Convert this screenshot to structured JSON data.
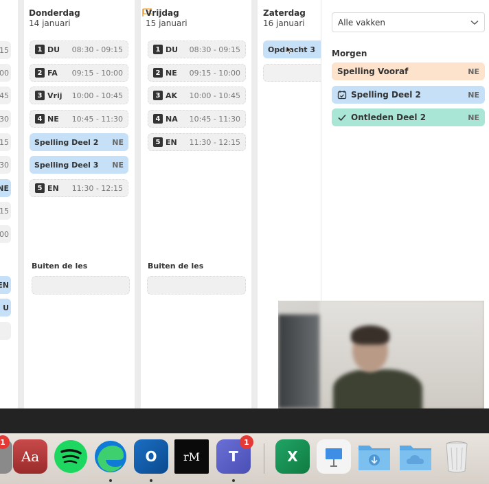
{
  "days": [
    {
      "name": "Donderdag",
      "date": "14 januari",
      "lessons": [
        {
          "num": "1",
          "subject": "DU",
          "time": "08:30 - 09:15"
        },
        {
          "num": "2",
          "subject": "FA",
          "time": "09:15 - 10:00"
        },
        {
          "num": "3",
          "subject": "Vrij",
          "time": "10:00 - 10:45"
        },
        {
          "num": "4",
          "subject": "NE",
          "time": "10:45 - 11:30"
        }
      ],
      "tasks": [
        {
          "name": "Spelling Deel 2",
          "subject": "NE"
        },
        {
          "name": "Spelling Deel 3",
          "subject": "NE"
        }
      ],
      "lesson5": {
        "num": "5",
        "subject": "EN",
        "time": "11:30 - 12:15"
      },
      "buiten_label": "Buiten de les"
    },
    {
      "name": "Vrijdag",
      "date": "15 januari",
      "lessons": [
        {
          "num": "1",
          "subject": "DU",
          "time": "08:30 - 09:15"
        },
        {
          "num": "2",
          "subject": "NE",
          "time": "09:15 - 10:00"
        },
        {
          "num": "3",
          "subject": "AK",
          "time": "10:00 - 10:45"
        },
        {
          "num": "4",
          "subject": "NA",
          "time": "10:45 - 11:30"
        },
        {
          "num": "5",
          "subject": "EN",
          "time": "11:30 - 12:15"
        }
      ],
      "buiten_label": "Buiten de les"
    },
    {
      "name": "Zaterdag",
      "date": "16 januari",
      "task": "Opdracht 3"
    }
  ],
  "left_partial": [
    "15",
    "00",
    "45",
    "30",
    "15",
    "30",
    "NE",
    "15",
    "15",
    "00",
    "EN",
    "U"
  ],
  "sidebar": {
    "filter": "Alle vakken",
    "heading": "Morgen",
    "items": [
      {
        "label": "Spelling Vooraf",
        "subject": "NE",
        "color": "#fde2cc",
        "icon": "none"
      },
      {
        "label": "Spelling Deel 2",
        "subject": "NE",
        "color": "#c5e0f7",
        "icon": "calendar-check-icon"
      },
      {
        "label": "Ontleden Deel 2",
        "subject": "NE",
        "color": "#a9e6d6",
        "icon": "checkmark-icon"
      }
    ]
  },
  "dock": [
    {
      "name": "app-icon",
      "badge": "1"
    },
    {
      "name": "dictionary-app",
      "text": "Aa"
    },
    {
      "name": "spotify-app"
    },
    {
      "name": "edge-app"
    },
    {
      "name": "outlook-app",
      "text": "O"
    },
    {
      "name": "remarkable-app",
      "text": "rM"
    },
    {
      "name": "teams-app",
      "text": "T",
      "badge": "1"
    },
    {
      "name": "excel-app",
      "text": "X"
    },
    {
      "name": "keynote-app"
    },
    {
      "name": "downloads-folder"
    },
    {
      "name": "icloud-folder"
    },
    {
      "name": "trash-app"
    }
  ]
}
